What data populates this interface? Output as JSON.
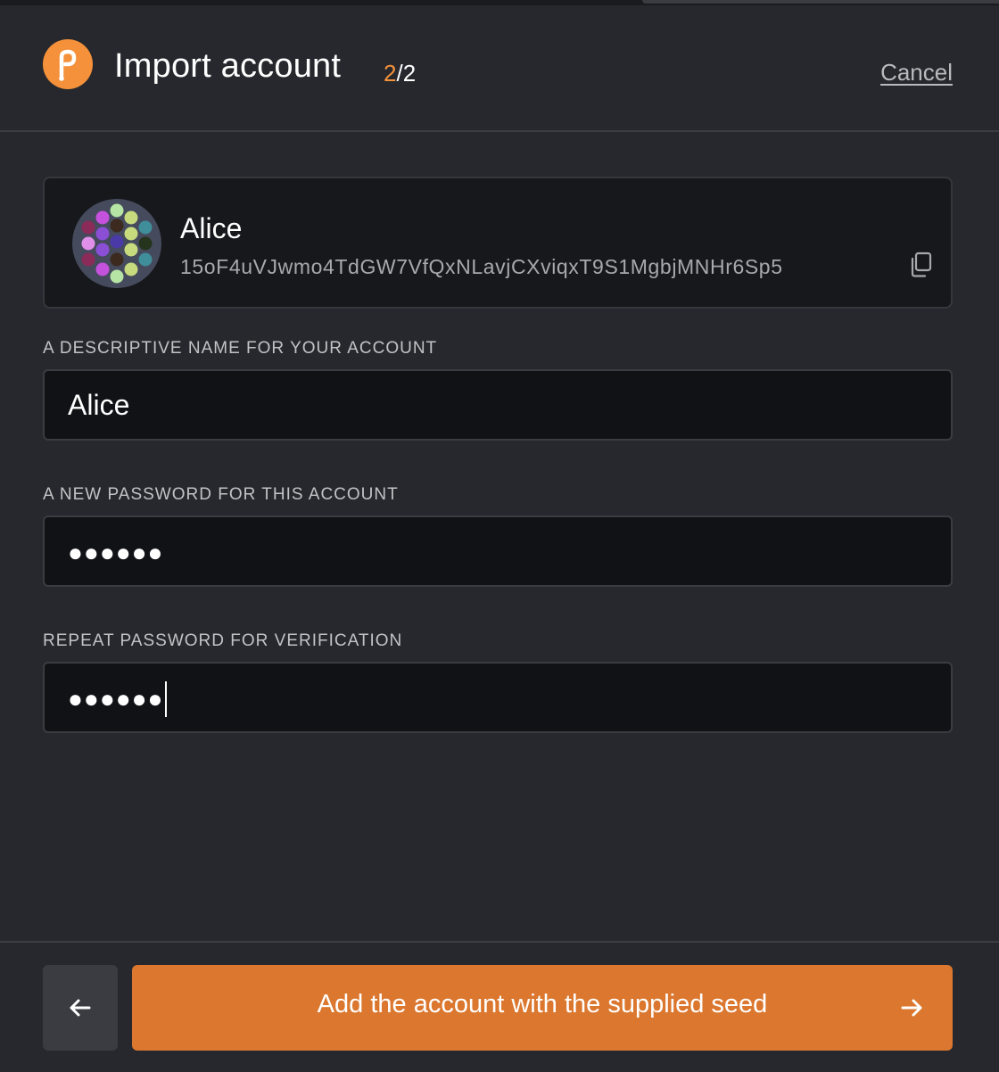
{
  "header": {
    "title": "Import account",
    "step_current": "2",
    "step_total": "/2",
    "cancel_label": "Cancel"
  },
  "account": {
    "name": "Alice",
    "address": "15oF4uVJwmo4TdGW7VfQxNLavjCXviqxT9S1MgbjMNHr6Sp5"
  },
  "fields": {
    "name_label": "A DESCRIPTIVE NAME FOR YOUR ACCOUNT",
    "name_value": "Alice",
    "password_label": "A NEW PASSWORD FOR THIS ACCOUNT",
    "password_masked": "●●●●●●",
    "repeat_label": "REPEAT PASSWORD FOR VERIFICATION",
    "repeat_masked": "●●●●●●"
  },
  "footer": {
    "submit_label": "Add the account with the supplied seed"
  },
  "colors": {
    "accent": "#f4913a",
    "button": "#db772e",
    "background": "#26282d"
  },
  "icons": [
    "polkadot-logo-icon",
    "identicon",
    "copy-icon",
    "arrow-left-icon",
    "arrow-right-icon"
  ]
}
